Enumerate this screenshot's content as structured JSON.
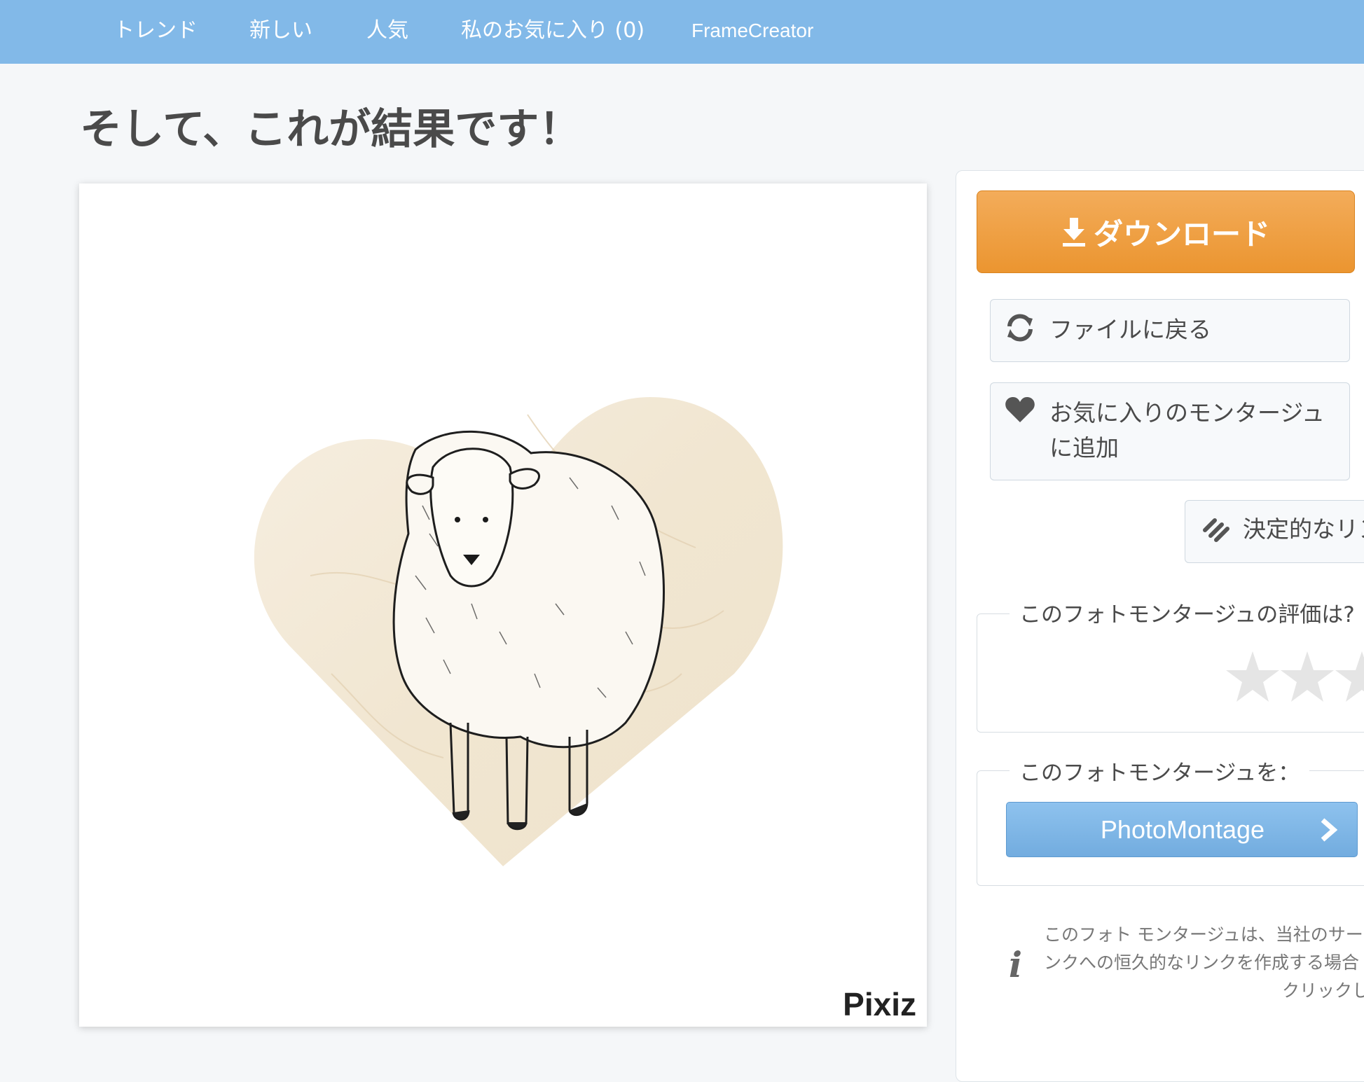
{
  "nav": {
    "items": [
      "トレンド",
      "新しい",
      "人気",
      "私のお気に入り (0)",
      "FrameCreator"
    ]
  },
  "page": {
    "title": "そして、これが結果です！"
  },
  "montage": {
    "watermark": "Pixiz"
  },
  "sidebar": {
    "download_label": "ダウンロード",
    "back_label": "ファイルに戻る",
    "favorite_label": "お気に入りのモンタージュに追加",
    "link_label": "決定的なリン",
    "rating_legend": "このフォトモンタージュの評価は?",
    "rating": {
      "stars_visible": 3,
      "filled": 0
    },
    "share_legend": "このフォトモンタージュを：",
    "share_button_label": "PhotoMontage",
    "info_lines": [
      "このフォト モンタージュは、当社のサー",
      "ンクへの恒久的なリンクを作成する場合",
      "クリックし"
    ]
  },
  "colors": {
    "nav_bg": "#82b9e8",
    "download": "#f0a040",
    "share_button": "#7fb7e6",
    "heart": "#f3ead9"
  }
}
